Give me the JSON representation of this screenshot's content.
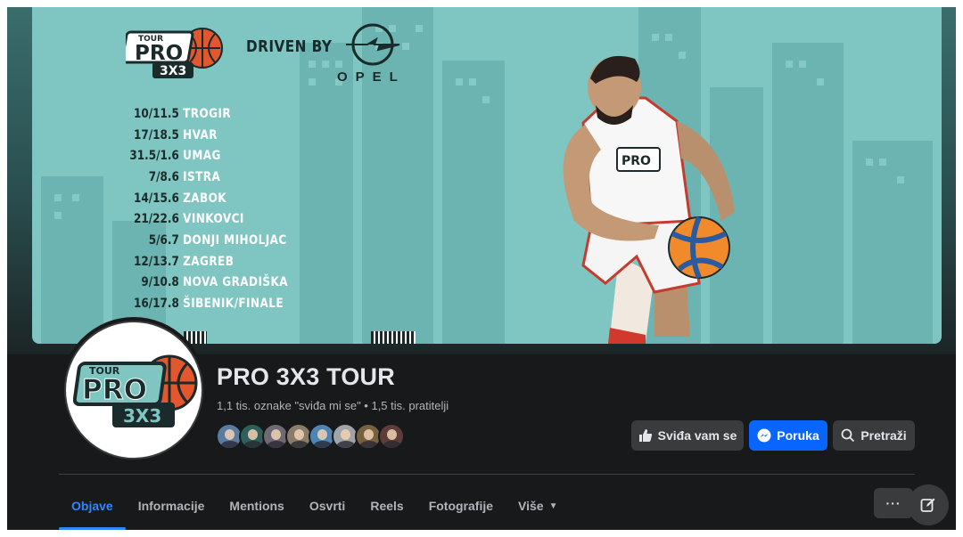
{
  "cover": {
    "driven_by": "DRIVEN BY",
    "sponsor": "OPEL",
    "logo_text": {
      "top": "TOUR",
      "main": "PRO",
      "sub": "3X3"
    },
    "schedule": [
      {
        "date": "10/11.5",
        "city": "TROGIR"
      },
      {
        "date": "17/18.5",
        "city": "HVAR"
      },
      {
        "date": "31.5/1.6",
        "city": "UMAG"
      },
      {
        "date": "7/8.6",
        "city": "ISTRA"
      },
      {
        "date": "14/15.6",
        "city": "ZABOK"
      },
      {
        "date": "21/22.6",
        "city": "VINKOVCI"
      },
      {
        "date": "5/6.7",
        "city": "DONJI MIHOLJAC"
      },
      {
        "date": "12/13.7",
        "city": "ZAGREB"
      },
      {
        "date": "9/10.8",
        "city": "NOVA GRADIŠKA"
      },
      {
        "date": "16/17.8",
        "city": "ŠIBENIK/FINALE"
      }
    ],
    "colors": {
      "background": "#7fc6c2",
      "city_text": "#ffffff",
      "date_text": "#1b2a2b"
    }
  },
  "profile": {
    "name": "PRO 3X3 TOUR",
    "stats": "1,1 tis. oznake \"sviđa mi se\" • 1,5 tis. pratitelji",
    "friend_avatars": 8
  },
  "actions": {
    "like": "Sviđa vam se",
    "message": "Poruka",
    "search": "Pretraži"
  },
  "tabs": [
    {
      "label": "Objave",
      "active": true
    },
    {
      "label": "Informacije",
      "active": false
    },
    {
      "label": "Mentions",
      "active": false
    },
    {
      "label": "Osvrti",
      "active": false
    },
    {
      "label": "Reels",
      "active": false
    },
    {
      "label": "Fotografije",
      "active": false
    },
    {
      "label": "Više",
      "active": false
    }
  ],
  "more_button": "···",
  "accent": "#2d88ff"
}
